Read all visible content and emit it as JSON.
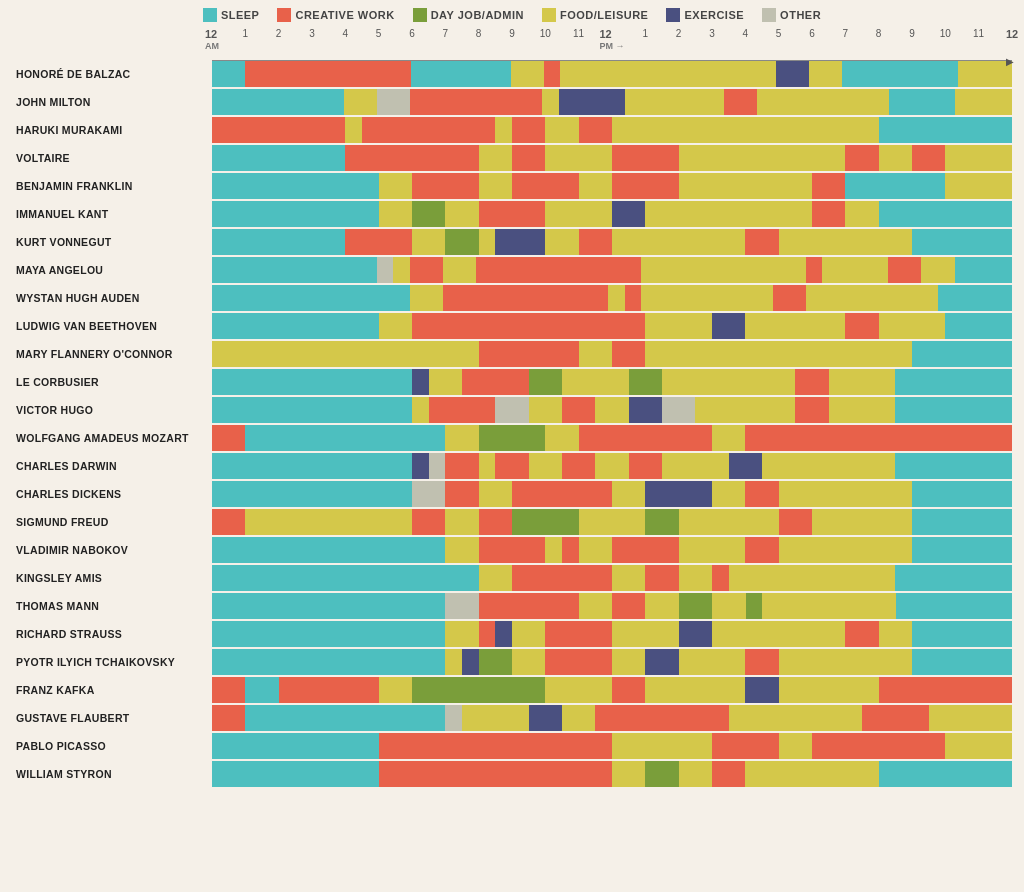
{
  "legend": {
    "items": [
      {
        "label": "SLEEP",
        "color": "sleep",
        "swatch": "#4dbfbf"
      },
      {
        "label": "CREATIVE WORK",
        "color": "creative",
        "swatch": "#e8614a"
      },
      {
        "label": "DAY JOB/ADMIN",
        "color": "dayjob",
        "swatch": "#7a9e3a"
      },
      {
        "label": "FOOD/LEISURE",
        "color": "food",
        "swatch": "#d4c84a"
      },
      {
        "label": "EXERCISE",
        "color": "exercise",
        "swatch": "#4a5080"
      },
      {
        "label": "OTHER",
        "color": "other",
        "swatch": "#c0c0b0"
      }
    ]
  },
  "timeAxis": {
    "labels": [
      "12\nAM",
      "1",
      "2",
      "3",
      "4",
      "5",
      "6",
      "7",
      "8",
      "9",
      "10",
      "11",
      "12\nPM",
      "1",
      "2",
      "3",
      "4",
      "5",
      "6",
      "7",
      "8",
      "9",
      "10",
      "11",
      "12"
    ]
  },
  "rows": [
    {
      "name": "HONORÉ DE BALZAC"
    },
    {
      "name": "JOHN MILTON"
    },
    {
      "name": "HARUKI MURAKAMI"
    },
    {
      "name": "VOLTAIRE"
    },
    {
      "name": "BENJAMIN FRANKLIN"
    },
    {
      "name": "IMMANUEL KANT"
    },
    {
      "name": "KURT VONNEGUT"
    },
    {
      "name": "MAYA ANGELOU"
    },
    {
      "name": "WYSTAN HUGH AUDEN"
    },
    {
      "name": "LUDWIG VAN BEETHOVEN"
    },
    {
      "name": "MARY FLANNERY O'CONNOR"
    },
    {
      "name": "LE CORBUSIER"
    },
    {
      "name": "VICTOR HUGO"
    },
    {
      "name": "WOLFGANG AMADEUS MOZART"
    },
    {
      "name": "CHARLES DARWIN"
    },
    {
      "name": "CHARLES DICKENS"
    },
    {
      "name": "SIGMUND FREUD"
    },
    {
      "name": "VLADIMIR NABOKOV"
    },
    {
      "name": "KINGSLEY AMIS"
    },
    {
      "name": "THOMAS MANN"
    },
    {
      "name": "RICHARD STRAUSS"
    },
    {
      "name": "PYOTR ILYICH TCHAIKOVSKY"
    },
    {
      "name": "FRANZ KAFKA"
    },
    {
      "name": "GUSTAVE FLAUBERT"
    },
    {
      "name": "PABLO PICASSO"
    },
    {
      "name": "WILLIAM STYRON"
    }
  ]
}
